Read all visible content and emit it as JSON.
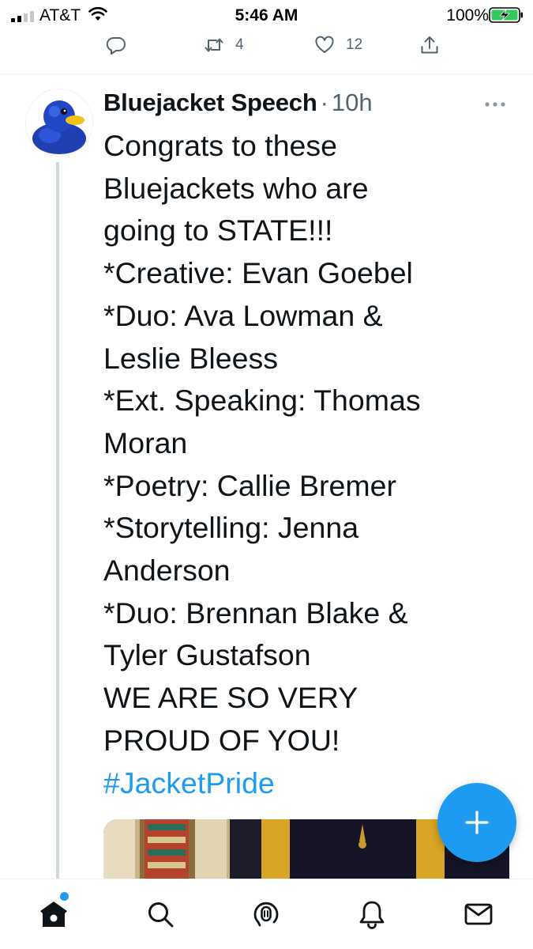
{
  "status_bar": {
    "carrier": "AT&T",
    "time": "5:46 AM",
    "battery_percent": "100%",
    "signal_bars": 2,
    "battery_level": 1.0
  },
  "previous_tweet_actions": {
    "reply_icon": "reply-icon",
    "retweet_icon": "retweet-icon",
    "retweet_count": "4",
    "like_icon": "heart-icon",
    "like_count": "12",
    "share_icon": "share-icon"
  },
  "tweet": {
    "display_name": "Bluejacket Speech",
    "separator": "·",
    "time_ago": "10h",
    "avatar_icon": "blue-rubber-duck-avatar",
    "body_lines": [
      "Congrats to these",
      "Bluejackets who are",
      "going to STATE!!!",
      "*Creative: Evan Goebel",
      "*Duo: Ava Lowman &",
      "Leslie Bleess",
      "*Ext. Speaking: Thomas",
      "Moran",
      "*Poetry: Callie Bremer",
      "*Storytelling: Jenna",
      "Anderson",
      "*Duo: Brennan Blake &",
      "Tyler Gustafson",
      "WE ARE SO VERY",
      "PROUD OF YOU!"
    ],
    "hashtag": "#JacketPride"
  },
  "fab": {
    "icon": "plus-icon"
  },
  "bottom_nav": {
    "items": [
      "home-icon",
      "search-icon",
      "spaces-icon",
      "notifications-icon",
      "messages-icon"
    ]
  },
  "colors": {
    "accent": "#1d9bf0",
    "secondary_text": "#536471",
    "primary_text": "#0f1419",
    "divider": "#eff3f4"
  }
}
